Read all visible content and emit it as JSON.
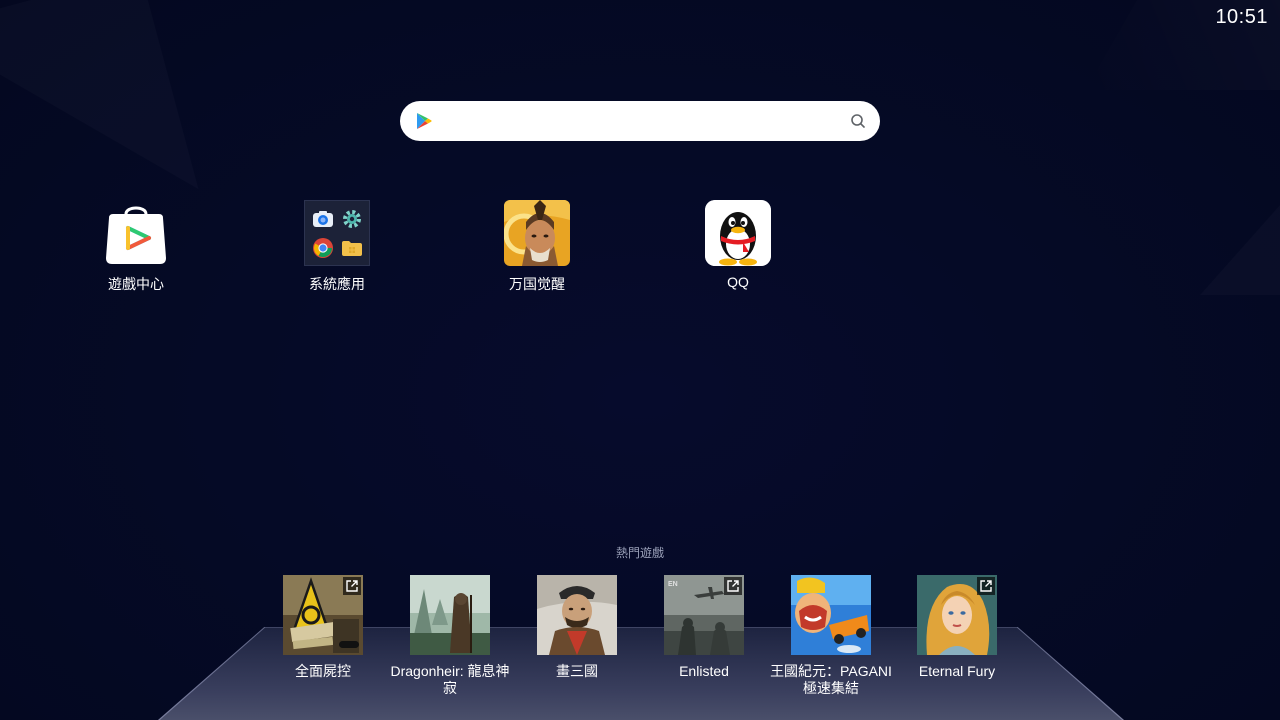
{
  "status_bar": {
    "time": "10:51"
  },
  "search": {
    "placeholder": ""
  },
  "desktop_apps": [
    {
      "label": "遊戲中心",
      "icon": "game-center-icon"
    },
    {
      "label": "系統應用",
      "icon": "system-apps-folder-icon"
    },
    {
      "label": "万国觉醒",
      "icon": "rise-of-kingdoms-icon"
    },
    {
      "label": "QQ",
      "icon": "qq-penguin-icon"
    }
  ],
  "hot_games": {
    "title": "熱門遊戲",
    "items": [
      {
        "label": "全面屍控",
        "icon": "state-of-survival-icon",
        "external": true
      },
      {
        "label": "Dragonheir: 龍息神寂",
        "icon": "dragonheir-icon",
        "external": false
      },
      {
        "label": "畫三國",
        "icon": "three-kingdoms-portrait-icon",
        "external": false
      },
      {
        "label": "Enlisted",
        "icon": "enlisted-icon",
        "external": true
      },
      {
        "label": "王國紀元：PAGANI極速集結",
        "icon": "lords-mobile-icon",
        "external": false
      },
      {
        "label": "Eternal Fury",
        "icon": "eternal-fury-icon",
        "external": true
      }
    ]
  },
  "colors": {
    "background": "#050a26",
    "tray": "#3a3f5e",
    "search_bg": "#ffffff",
    "muted_text": "#9aa0b8"
  }
}
